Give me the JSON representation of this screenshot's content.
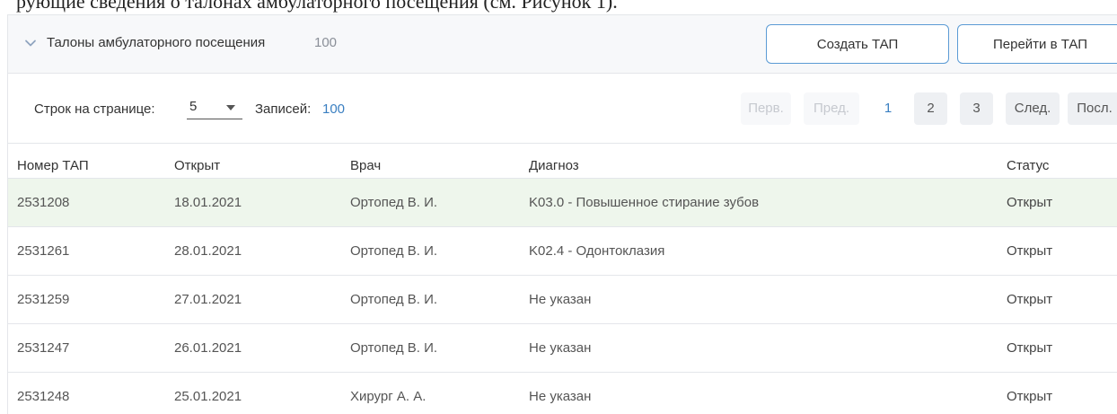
{
  "caption_fragment": "рующие сведения о талонах амбулаторного посещения (см. Рисунок 1).",
  "panel": {
    "title": "Талоны амбулаторного посещения",
    "count": "100",
    "create_button": "Создать ТАП",
    "goto_button": "Перейти в ТАП"
  },
  "pagination": {
    "rows_label": "Строк на странице:",
    "rows_value": "5",
    "records_label": "Записей:",
    "records_count": "100",
    "first": "Перв.",
    "prev": "Пред.",
    "pages": [
      "1",
      "2",
      "3"
    ],
    "current_page": "1",
    "next": "След.",
    "last": "Посл."
  },
  "table": {
    "columns": [
      "Номер ТАП",
      "Открыт",
      "Врач",
      "Диагноз",
      "Статус"
    ],
    "rows": [
      {
        "number": "2531208",
        "opened": "18.01.2021",
        "doctor": "Ортопед В. И.",
        "diagnosis": "K03.0 - Повышенное стирание зубов",
        "status": "Открыт"
      },
      {
        "number": "2531261",
        "opened": "28.01.2021",
        "doctor": "Ортопед В. И.",
        "diagnosis": "K02.4 - Одонтоклазия",
        "status": "Открыт"
      },
      {
        "number": "2531259",
        "opened": "27.01.2021",
        "doctor": "Ортопед В. И.",
        "diagnosis": "Не указан",
        "status": "Открыт"
      },
      {
        "number": "2531247",
        "opened": "26.01.2021",
        "doctor": "Ортопед В. И.",
        "diagnosis": "Не указан",
        "status": "Открыт"
      },
      {
        "number": "2531248",
        "opened": "25.01.2021",
        "doctor": "Хирург А. А.",
        "diagnosis": "Не указан",
        "status": "Открыт"
      }
    ],
    "selected_row": 0
  },
  "colors": {
    "accent": "#3a7fc1",
    "button_border": "#5b9bd5",
    "selected_row": "#eef6ec",
    "header_bg": "#f7f8fa"
  },
  "icons": {
    "collapse": "chevron-down-icon",
    "rows_select": "caret-down-icon"
  }
}
